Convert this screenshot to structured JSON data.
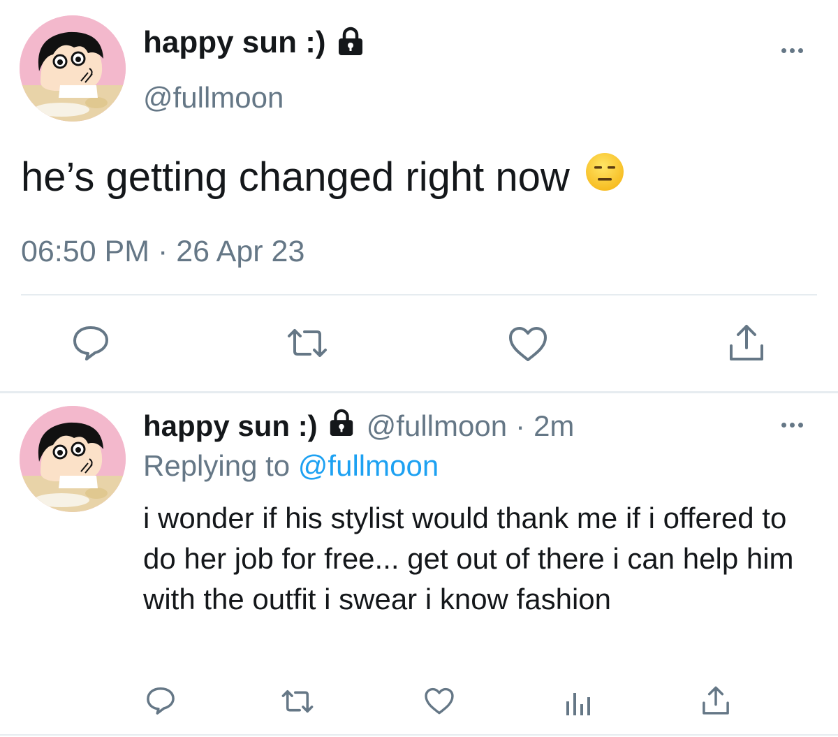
{
  "main_tweet": {
    "display_name": "happy sun :)",
    "handle": "@fullmoon",
    "text": "he’s getting changed right now",
    "emoji": "expressionless-face",
    "timestamp": "06:50 PM · 26 Apr 23"
  },
  "reply_tweet": {
    "display_name": "happy sun :)",
    "handle": "@fullmoon",
    "separator": "·",
    "time": "2m",
    "replying_prefix": "Replying to",
    "replying_handle": "@fullmoon",
    "text": "i wonder if his stylist would thank me if i offered to do her job for free... get out of there i can help him with the outfit i swear i know fashion"
  },
  "icons": {
    "lock": "lock-icon",
    "more": "more-icon",
    "reply": "reply-icon",
    "retweet": "retweet-icon",
    "like": "heart-icon",
    "analytics": "analytics-icon",
    "share": "share-icon"
  },
  "colors": {
    "text": "#14171a",
    "secondary": "#657786",
    "link": "#1da1f2",
    "divider": "#e6ecf0"
  }
}
